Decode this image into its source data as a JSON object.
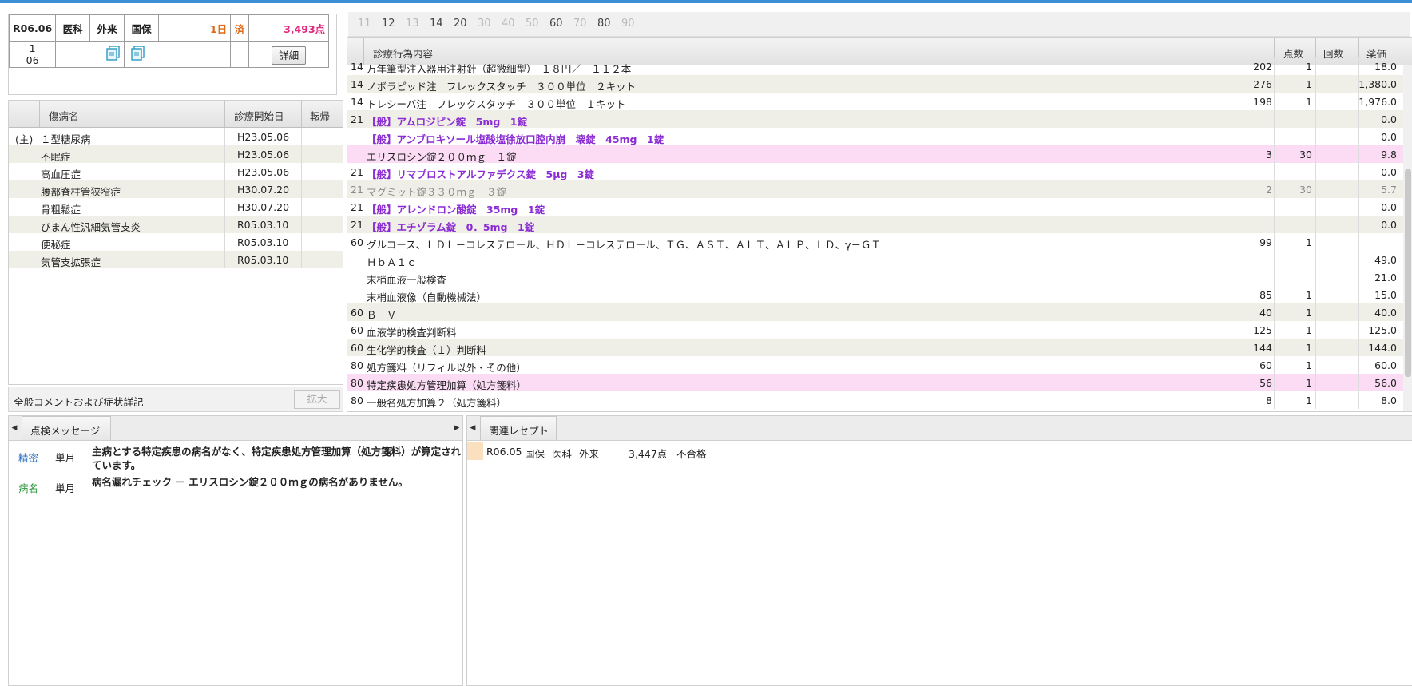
{
  "summary": {
    "date": "R06.06",
    "dept": "医科",
    "visit": "外来",
    "insurance": "国保",
    "days": "1日",
    "status": "済",
    "points": "3,493点",
    "row2_top": "1",
    "row2_bottom": "06",
    "detail_label": "詳細"
  },
  "diseases": {
    "headers": {
      "name": "傷病名",
      "start": "診療開始日",
      "outcome": "転帰"
    },
    "rows": [
      {
        "main": "(主)",
        "name": "１型糖尿病",
        "start": "H23.05.06"
      },
      {
        "main": "",
        "name": "不眠症",
        "start": "H23.05.06"
      },
      {
        "main": "",
        "name": "高血圧症",
        "start": "H23.05.06"
      },
      {
        "main": "",
        "name": "腰部脊柱管狭窄症",
        "start": "H30.07.20"
      },
      {
        "main": "",
        "name": "骨粗鬆症",
        "start": "H30.07.20"
      },
      {
        "main": "",
        "name": "びまん性汎細気管支炎",
        "start": "R05.03.10"
      },
      {
        "main": "",
        "name": "便秘症",
        "start": "R05.03.10"
      },
      {
        "main": "",
        "name": "気管支拡張症",
        "start": "R05.03.10"
      }
    ]
  },
  "comment_bar": {
    "label": "全般コメントおよび症状詳記",
    "expand_label": "拡大"
  },
  "number_tabs": [
    {
      "n": "11",
      "on": false
    },
    {
      "n": "12",
      "on": true
    },
    {
      "n": "13",
      "on": false
    },
    {
      "n": "14",
      "on": true
    },
    {
      "n": "20",
      "on": true
    },
    {
      "n": "30",
      "on": false
    },
    {
      "n": "40",
      "on": false
    },
    {
      "n": "50",
      "on": false
    },
    {
      "n": "60",
      "on": true
    },
    {
      "n": "70",
      "on": false
    },
    {
      "n": "80",
      "on": true
    },
    {
      "n": "90",
      "on": false
    }
  ],
  "treatments": {
    "headers": {
      "content": "診療行為内容",
      "points": "点数",
      "count": "回数",
      "price": "薬価"
    },
    "rows": [
      {
        "code": "14",
        "name": "万年筆型注入器用注射針（超微細型）　１８円／　１１２本",
        "points": "202",
        "count": "1",
        "price": "18.0",
        "style": "plain"
      },
      {
        "code": "14",
        "name": "ノボラピッド注　フレックスタッチ　３００単位　２キット",
        "points": "276",
        "count": "1",
        "price": "1,380.0",
        "style": "alt"
      },
      {
        "code": "14",
        "name": "トレシーバ注　フレックスタッチ　３００単位　１キット",
        "points": "198",
        "count": "1",
        "price": "1,976.0",
        "style": "plain"
      },
      {
        "code": "21",
        "name": "【般】アムロジピン錠　5mg　1錠",
        "points": "",
        "count": "",
        "price": "0.0",
        "style": "alt bold"
      },
      {
        "code": "",
        "name": "【般】アンブロキソール塩酸塩徐放口腔内崩　壊錠　45mg　1錠",
        "points": "",
        "count": "",
        "price": "0.0",
        "style": "plain bold"
      },
      {
        "code": "",
        "name": "エリスロシン錠２００ｍｇ　１錠",
        "points": "3",
        "count": "30",
        "price": "9.8",
        "style": "hl"
      },
      {
        "code": "21",
        "name": "【般】リマプロストアルファデクス錠　5μg　3錠",
        "points": "",
        "count": "",
        "price": "0.0",
        "style": "plain bold"
      },
      {
        "code": "21",
        "name": "マグミット錠３３０ｍｇ　３錠",
        "points": "2",
        "count": "30",
        "price": "5.7",
        "style": "alt grey"
      },
      {
        "code": "21",
        "name": "【般】アレンドロン酸錠　35mg　1錠",
        "points": "",
        "count": "",
        "price": "0.0",
        "style": "plain bold"
      },
      {
        "code": "21",
        "name": "【般】エチゾラム錠　0．5mg　1錠",
        "points": "",
        "count": "",
        "price": "0.0",
        "style": "alt bold"
      },
      {
        "code": "60",
        "name": "グルコース、ＬＤＬ－コレステロール、ＨＤＬ－コレステロール、ＴＧ、ＡＳＴ、ＡＬＴ、ＡＬＰ、ＬＤ、γ－ＧＴ",
        "points": "99",
        "count": "1",
        "price": "",
        "style": "plain"
      },
      {
        "code": "",
        "name": "ＨｂＡ１ｃ",
        "points": "",
        "count": "",
        "price": "49.0",
        "style": "plain"
      },
      {
        "code": "",
        "name": "末梢血液一般検査",
        "points": "",
        "count": "",
        "price": "21.0",
        "style": "plain"
      },
      {
        "code": "",
        "name": "末梢血液像（自動機械法）",
        "points": "85",
        "count": "1",
        "price": "15.0",
        "style": "plain"
      },
      {
        "code": "60",
        "name": "Ｂ－Ｖ",
        "points": "40",
        "count": "1",
        "price": "40.0",
        "style": "alt"
      },
      {
        "code": "60",
        "name": "血液学的検査判断料",
        "points": "125",
        "count": "1",
        "price": "125.0",
        "style": "plain"
      },
      {
        "code": "60",
        "name": "生化学的検査（１）判断料",
        "points": "144",
        "count": "1",
        "price": "144.0",
        "style": "alt"
      },
      {
        "code": "80",
        "name": "処方箋料（リフィル以外・その他）",
        "points": "60",
        "count": "1",
        "price": "60.0",
        "style": "plain"
      },
      {
        "code": "80",
        "name": "特定疾患処方管理加算（処方箋料）",
        "points": "56",
        "count": "1",
        "price": "56.0",
        "style": "hl"
      },
      {
        "code": "80",
        "name": "一般名処方加算２（処方箋料）",
        "points": "8",
        "count": "1",
        "price": "8.0",
        "style": "plain"
      }
    ]
  },
  "messages": {
    "tab_label": "点検メッセージ",
    "items": [
      {
        "category": "精密",
        "category_color": "#2a6fc0",
        "period": "単月",
        "text": "主病とする特定疾患の病名がなく、特定疾患処方管理加算（処方箋料）が算定されています。"
      },
      {
        "category": "病名",
        "category_color": "#2f9a3e",
        "period": "単月",
        "text": "病名漏れチェック － エリスロシン錠２００ｍｇの病名がありません。"
      }
    ]
  },
  "related": {
    "tab_label": "関連レセプト",
    "items": [
      {
        "date": "R06.05",
        "insurance": "国保",
        "dept": "医科",
        "visit": "外来",
        "points": "3,447点",
        "result": "不合格"
      }
    ]
  }
}
